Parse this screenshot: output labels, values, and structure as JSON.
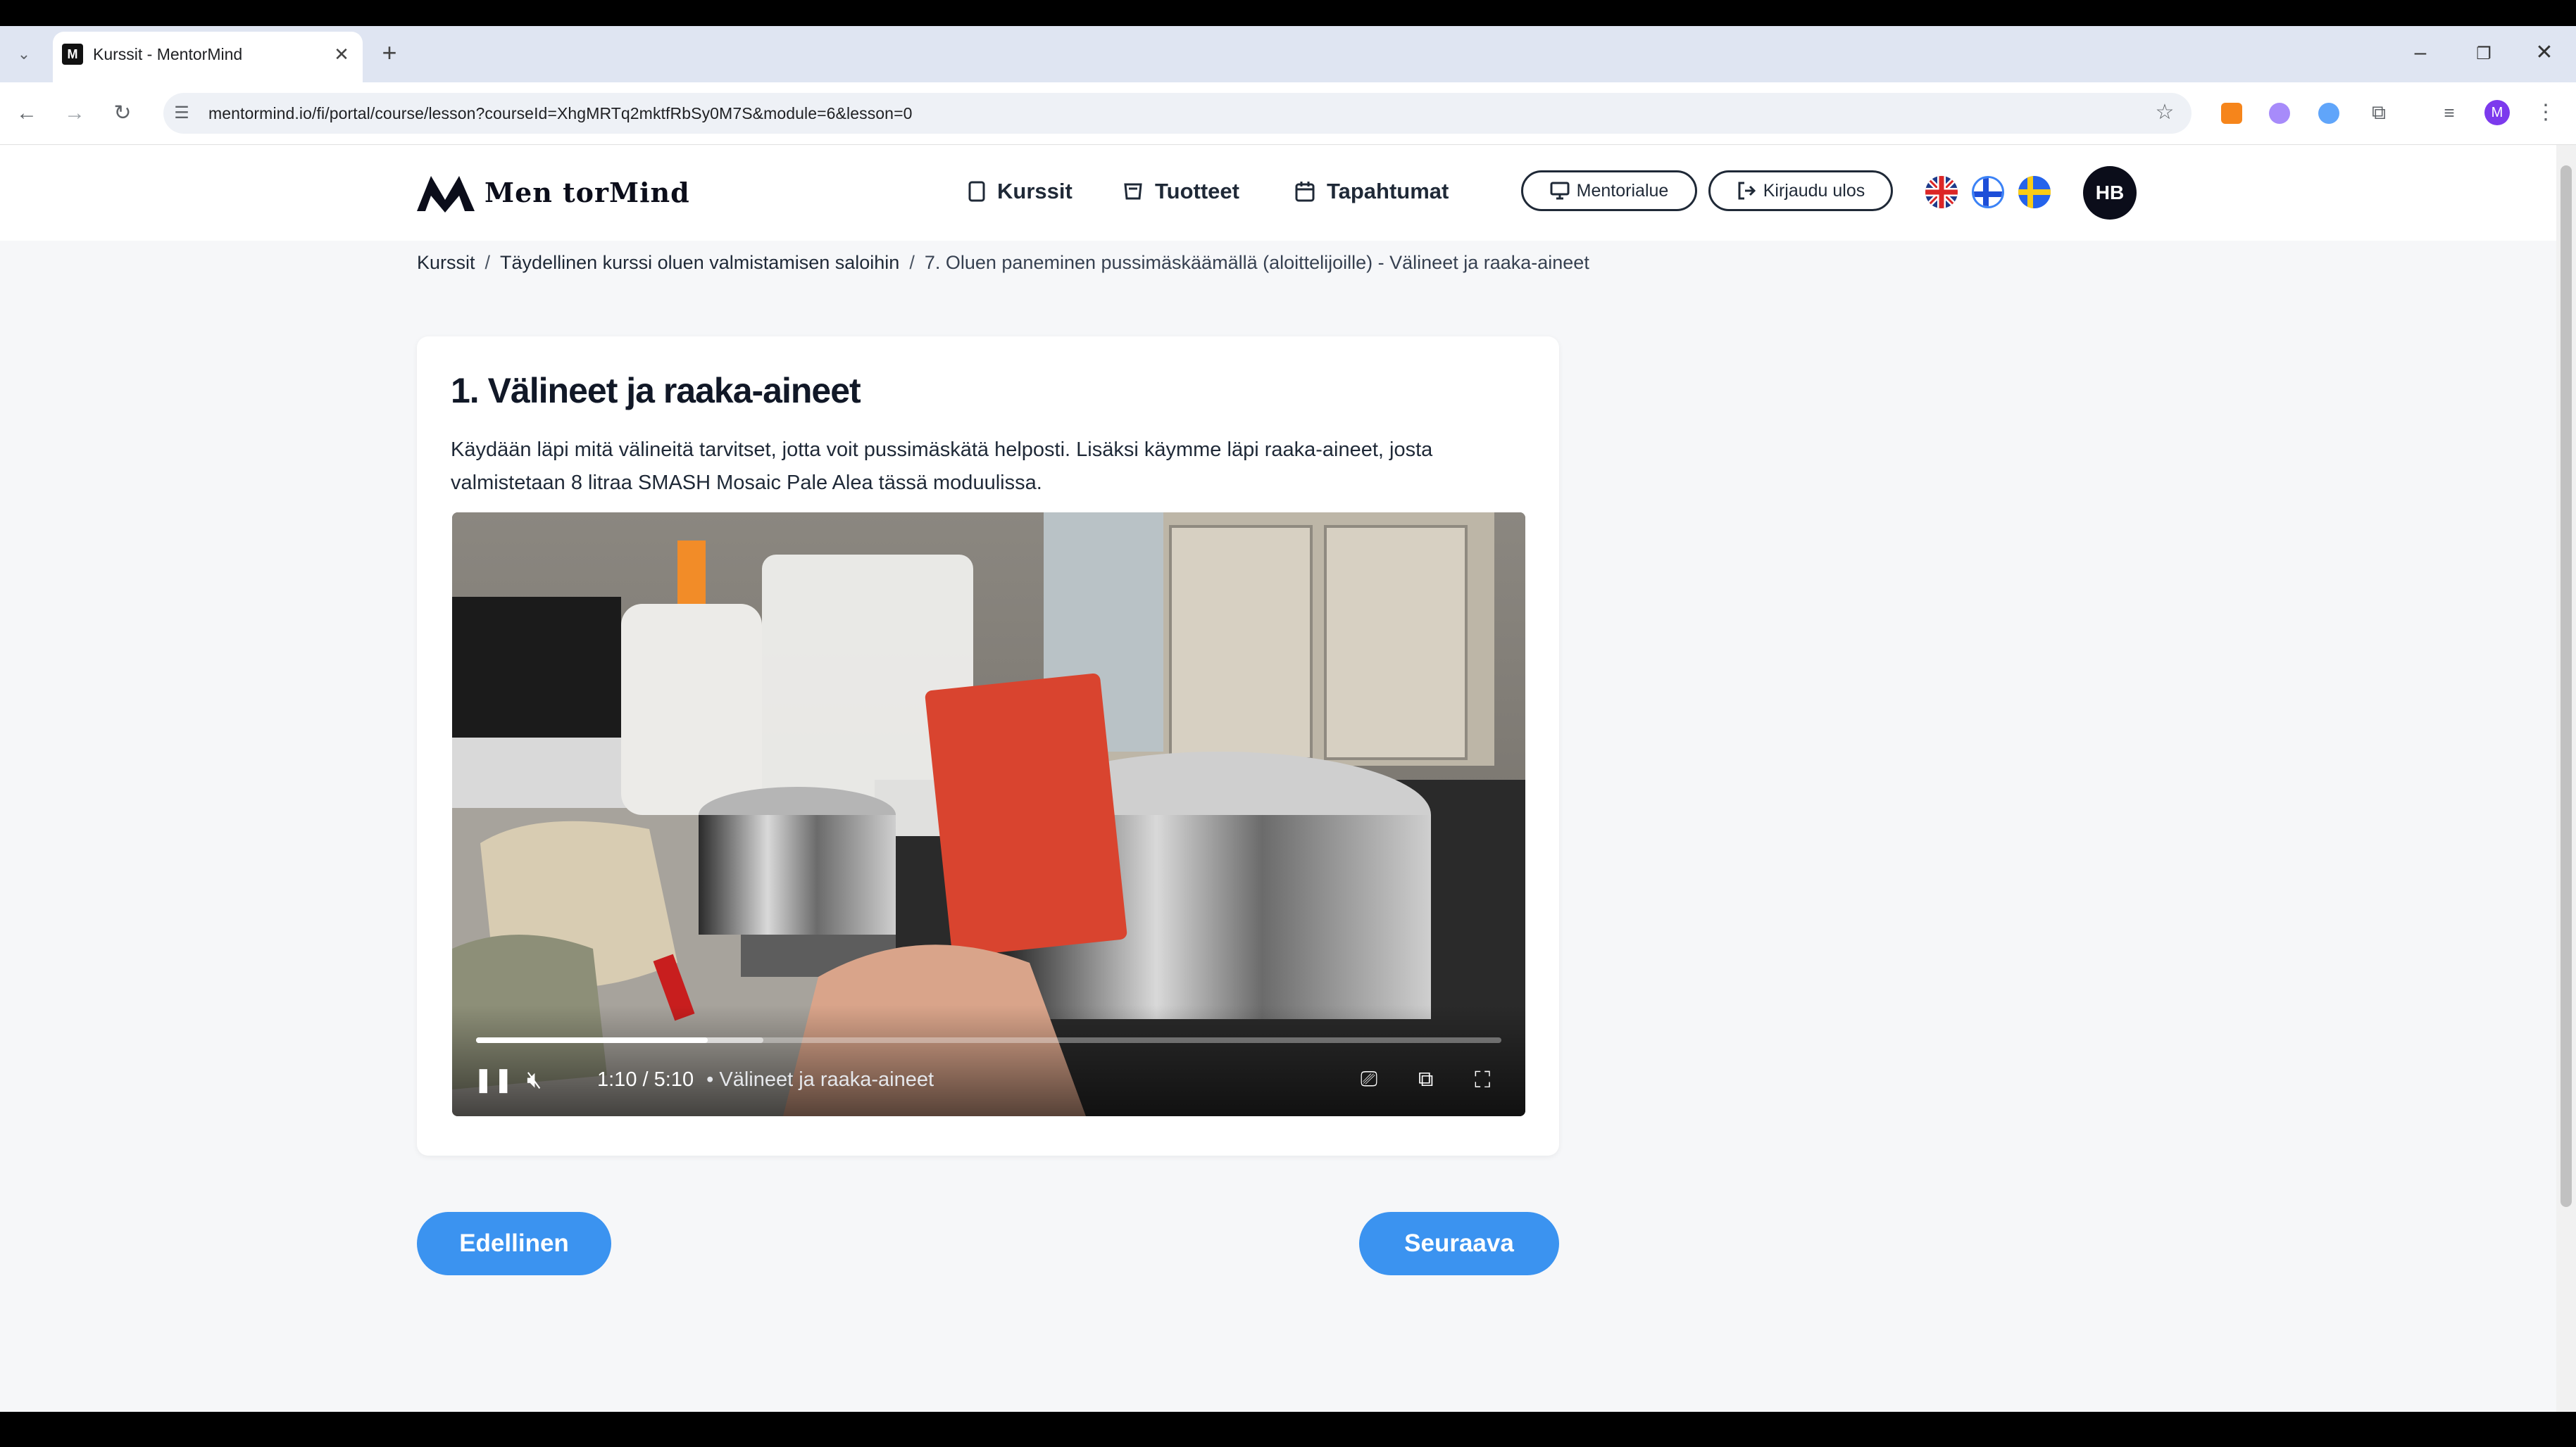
{
  "browser": {
    "tab_title": "Kurssit - MentorMind",
    "url": "mentormind.io/fi/portal/course/lesson?courseId=XhgMRTq2mktfRbSy0M7S&module=6&lesson=0",
    "profile_initial": "M"
  },
  "site": {
    "logo_text": "Men torMind",
    "nav": [
      {
        "label": "Kurssit",
        "icon": "book-icon"
      },
      {
        "label": "Tuotteet",
        "icon": "cart-icon"
      },
      {
        "label": "Tapahtumat",
        "icon": "calendar-icon"
      }
    ],
    "mentor_button": "Mentorialue",
    "logout_button": "Kirjaudu ulos",
    "avatar": "HB",
    "languages": [
      "en",
      "fi",
      "sv"
    ]
  },
  "breadcrumb": {
    "items": [
      "Kurssit",
      "Täydellinen kurssi oluen valmistamisen saloihin",
      "7. Oluen paneminen pussimäskäämällä (aloittelijoille) - Välineet ja raaka-aineet"
    ],
    "separator": "/"
  },
  "lesson": {
    "title": "1. Välineet ja raaka-aineet",
    "description": "Käydään läpi mitä välineitä tarvitset, jotta voit pussimäskätä helposti. Lisäksi käymme läpi raaka-aineet, josta valmistetaan 8 litraa SMASH Mosaic Pale Alea tässä moduulissa."
  },
  "video": {
    "current_time": "1:10",
    "duration": "5:10",
    "separator": " / ",
    "chapter": "• Välineet ja raaka-aineet",
    "progress": 0.2258,
    "buffered": 0.28
  },
  "buttons": {
    "previous": "Edellinen",
    "next": "Seuraava"
  },
  "colors": {
    "accent": "#3b93f0",
    "text": "#1f2937"
  }
}
